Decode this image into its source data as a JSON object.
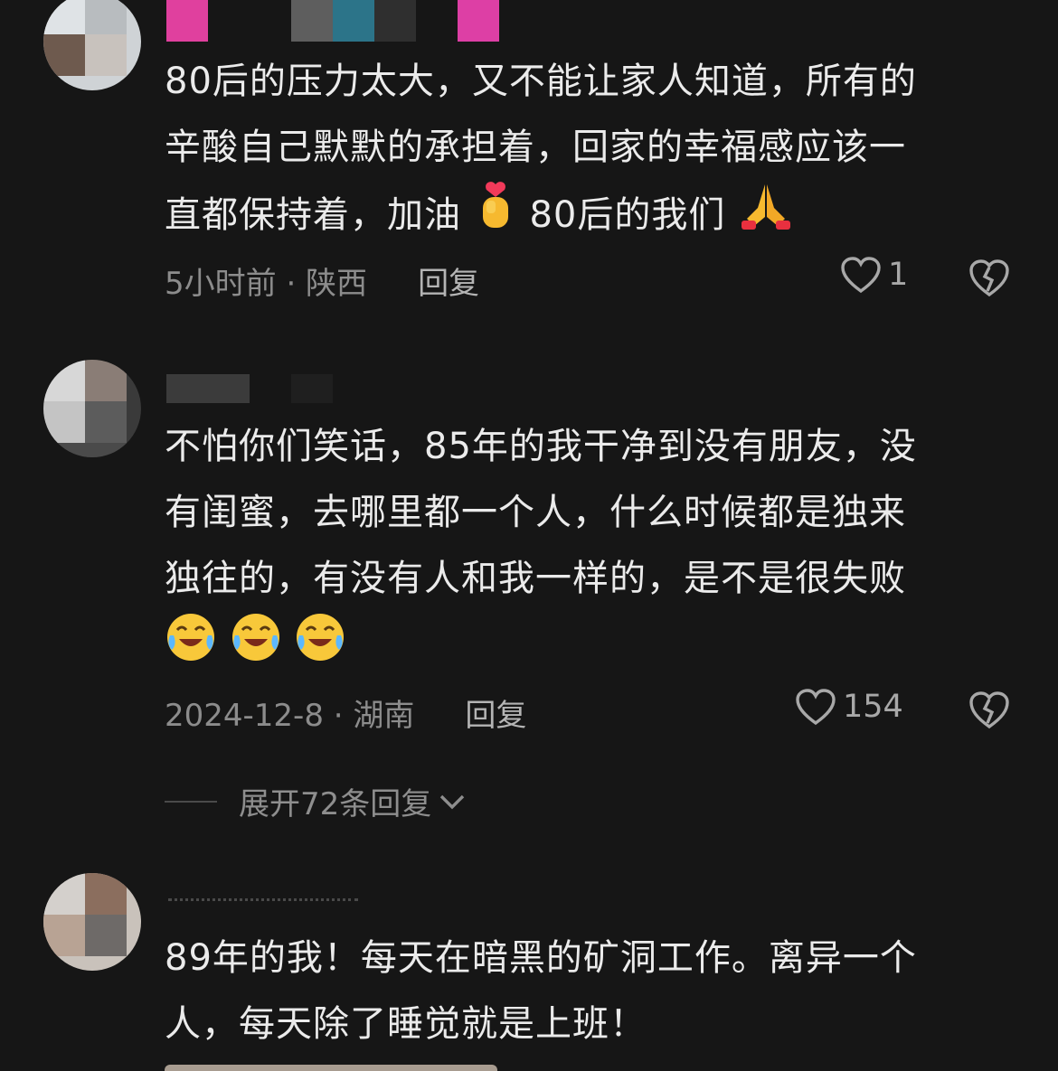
{
  "comments": [
    {
      "text_lines": [
        "80后的压力太大，又不能让家人知道，所有的",
        "辛酸自己默默的承担着，回家的幸福感应该一"
      ],
      "text_line3a": "直都保持着，加油",
      "text_line3b": "80后的我们",
      "time_location": "5小时前 · 陕西",
      "reply_label": "回复",
      "likes": "1",
      "emojis": [
        "heart-hands-emoji",
        "praying-hands-emoji"
      ]
    },
    {
      "text_lines": [
        "不怕你们笑话，85年的我干净到没有朋友，没",
        "有闺蜜，去哪里都一个人，什么时候都是独来",
        "独往的，有没有人和我一样的，是不是很失败"
      ],
      "time_location": "2024-12-8 · 湖南",
      "reply_label": "回复",
      "likes": "154",
      "emojis": [
        "crying-laughing-emoji",
        "crying-laughing-emoji",
        "crying-laughing-emoji"
      ]
    },
    {
      "text_lines": [
        "89年的我！每天在暗黑的矿洞工作。离异一个",
        "人，每天除了睡觉就是上班！"
      ]
    }
  ],
  "expand_replies": "展开72条回复",
  "colors": {
    "background": "#161616",
    "text": "#ebebeb",
    "meta": "#8c8c8c",
    "icon": "#a8a8a8"
  }
}
